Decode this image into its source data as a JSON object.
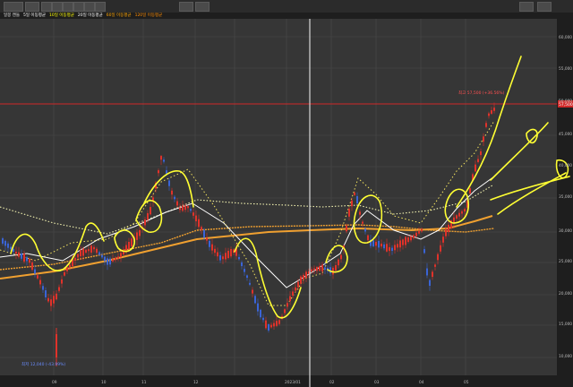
{
  "toolbar": {
    "controls": [
      "selector",
      "period",
      "d",
      "w",
      "m",
      "min",
      "tick",
      "sec",
      "search",
      "settings",
      "zoom",
      "window"
    ]
  },
  "legend": {
    "items": [
      {
        "text": "일봉 캔들",
        "color": "#e8e8e8"
      },
      {
        "text": "5일 이동평균",
        "color": "#ffffff"
      },
      {
        "text": "10일 이동평균",
        "color": "#ffff00"
      },
      {
        "text": "20일 이동평균",
        "color": "#ffffff"
      },
      {
        "text": "60일 이동평균",
        "color": "#ffa500"
      },
      {
        "text": "120일 이동평균",
        "color": "#ff8c00"
      }
    ]
  },
  "price_axis": {
    "labels": [
      "60,000",
      "55,000",
      "50,000",
      "45,000",
      "40,000",
      "35,000",
      "30,000",
      "25,000",
      "20,000",
      "15,000",
      "10,000"
    ]
  },
  "markers": {
    "high_label": "최고 57,500 (+36.56%)",
    "high_price_tag": "57,500",
    "low_label": "최저 12,040 (-43.99%)"
  },
  "time_axis": {
    "labels": [
      "09",
      "10",
      "11",
      "12",
      "2023/01",
      "02",
      "03",
      "04",
      "05"
    ]
  },
  "colors": {
    "background": "#363636",
    "grid": "#4a4a4a",
    "up_candle": "#e0322a",
    "down_candle": "#3a64d6",
    "highlight": "#ffff33",
    "ma_white": "#ffffff",
    "ma_orange": "#f0a030",
    "resistance_line": "#d02828"
  },
  "icons": {
    "crosshair": "vertical-cursor-line"
  }
}
